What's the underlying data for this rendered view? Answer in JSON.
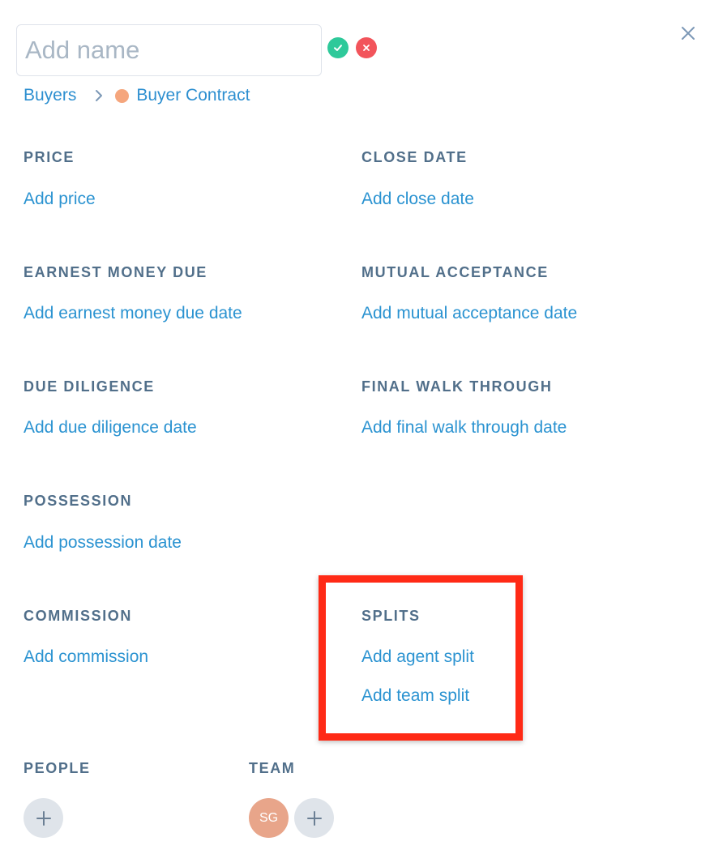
{
  "header": {
    "name_placeholder": "Add name",
    "name_value": ""
  },
  "breadcrumb": {
    "parent": "Buyers",
    "stage": "Buyer Contract",
    "stage_color": "#f5a67d"
  },
  "fields": {
    "price": {
      "label": "PRICE",
      "action": "Add price"
    },
    "close_date": {
      "label": "CLOSE DATE",
      "action": "Add close date"
    },
    "earnest_money_due": {
      "label": "EARNEST MONEY DUE",
      "action": "Add earnest money due date"
    },
    "mutual_acceptance": {
      "label": "MUTUAL ACCEPTANCE",
      "action": "Add mutual acceptance date"
    },
    "due_diligence": {
      "label": "DUE DILIGENCE",
      "action": "Add due diligence date"
    },
    "final_walk_through": {
      "label": "FINAL WALK THROUGH",
      "action": "Add final walk through date"
    },
    "possession": {
      "label": "POSSESSION",
      "action": "Add possession date"
    },
    "commission": {
      "label": "COMMISSION",
      "action": "Add commission"
    },
    "splits": {
      "label": "SPLITS",
      "agent_action": "Add agent split",
      "team_action": "Add team split"
    }
  },
  "people": {
    "label": "PEOPLE"
  },
  "team": {
    "label": "TEAM",
    "avatar_initials": "SG",
    "avatar_color": "#e8a58a"
  },
  "colors": {
    "link": "#2b93d1",
    "label": "#516f8a",
    "confirm": "#2ec99a",
    "cancel": "#f2545b",
    "highlight": "#ff2a16"
  },
  "icons": {
    "confirm": "check-icon",
    "cancel": "x-icon",
    "close": "close-icon",
    "breadcrumb_separator": "chevron-right-icon",
    "add": "plus-icon"
  }
}
